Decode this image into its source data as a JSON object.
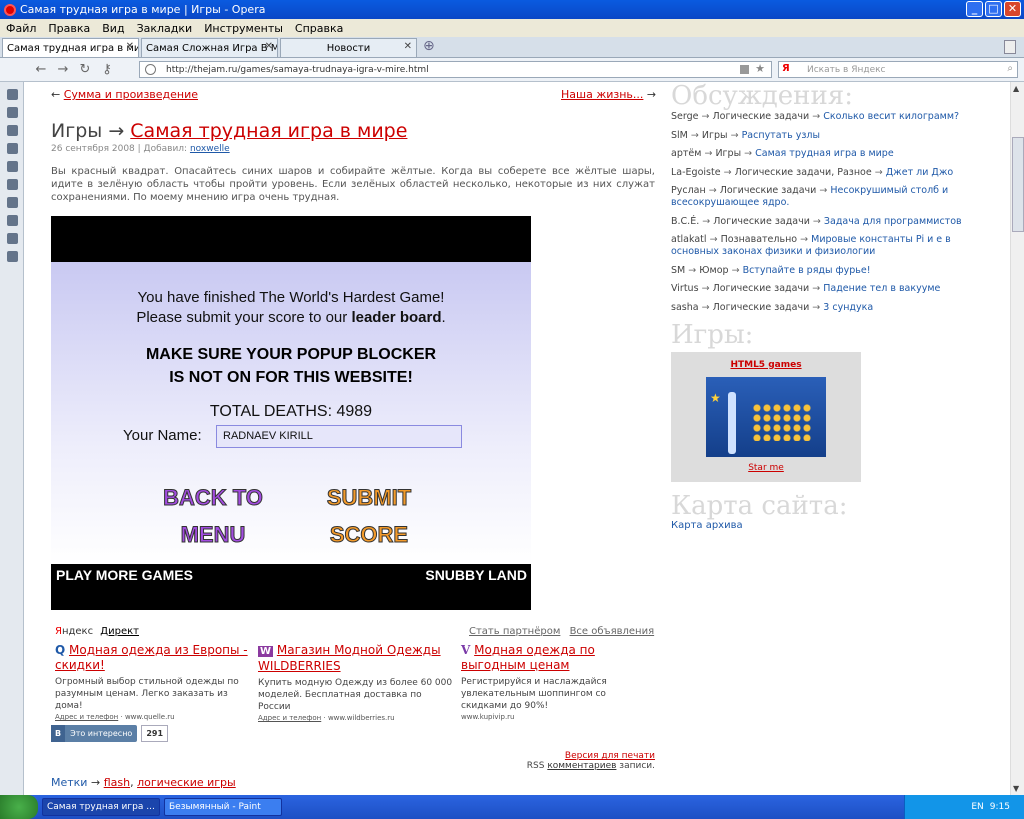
{
  "window": {
    "title": "Самая трудная игра в мире | Игры - Opera",
    "min": "_",
    "max": "□",
    "close": "✕"
  },
  "menu": [
    "Файл",
    "Правка",
    "Вид",
    "Закладки",
    "Инструменты",
    "Справка"
  ],
  "tabs": [
    {
      "label": "Самая трудная игра в мир...",
      "close": "✕"
    },
    {
      "label": "Самая Сложная Игра В Мир...",
      "close": "✕"
    },
    {
      "label": "Новости",
      "close": "✕"
    }
  ],
  "address": {
    "url": "http://thejam.ru/games/samaya-trudnaya-igra-v-mire.html",
    "search_placeholder": "Искать в Яндекс",
    "search_brand": "Я"
  },
  "nav": {
    "prev": "Сумма и произведение",
    "next": "Наша жизнь...",
    "prev_arrow": "←",
    "next_arrow": "→"
  },
  "article": {
    "category": "Игры",
    "arrow": "→",
    "title": "Самая трудная игра в мире",
    "date": "26 сентября 2008 | Добавил:",
    "author": "noxwelle",
    "text": "Вы красный квадрат. Опасайтесь синих шаров и собирайте жёлтые. Когда вы соберете все жёлтые шары, идите в зелёную область чтобы пройти уровень. Если зелёных областей несколько, некоторые из них служат сохранениями. По моему мнению игра очень трудная."
  },
  "game": {
    "line1": "You have finished The World's Hardest Game!",
    "line2_pre": "Please submit your score to our ",
    "line2_bold": "leader board",
    "line2_post": ".",
    "warn1": "MAKE SURE YOUR POPUP BLOCKER",
    "warn2": "IS NOT ON FOR THIS WEBSITE!",
    "deaths": "TOTAL DEATHS: 4989",
    "name_label": "Your Name:",
    "name_value": "RADNAEV KIRILL",
    "back1": "BACK TO",
    "back2": "MENU",
    "submit1": "SUBMIT",
    "submit2": "SCORE",
    "more_games": "PLAY MORE GAMES",
    "snubby": "SNUBBY LAND"
  },
  "ads": {
    "brand_ya": "Я",
    "brand_ndex": "ндекс",
    "direct": "Директ",
    "partner": "Стать партнёром",
    "all": "Все объявления",
    "items": [
      {
        "icon": "Q",
        "title": "Модная одежда из Европы - скидки!",
        "text": "Огромный выбор стильной одежды по разумным ценам. Легко заказать из дома!",
        "addr": "Адрес и телефон",
        "domain": "www.quelle.ru"
      },
      {
        "icon": "W",
        "title": "Магазин Модной Одежды WILDBERRIES",
        "text": "Купить модную Одежду из более 60 000 моделей. Бесплатная доставка по России",
        "addr": "Адрес и телефон",
        "domain": "www.wildberries.ru"
      },
      {
        "icon": "V",
        "title": "Модная одежда по выгодным ценам",
        "text": "Регистрируйся и наслаждайся увлекательным шоппингом со скидками до 90%!",
        "addr": "",
        "domain": "www.kupivip.ru"
      }
    ]
  },
  "social": {
    "vk": "В",
    "label": "Это интересно",
    "count": "291"
  },
  "print": "Версия для печати",
  "rss": {
    "pre": "RSS ",
    "link": "комментариев",
    "post": " записи."
  },
  "tags": {
    "label": "Метки",
    "arrow": "→",
    "items": [
      "flash",
      "логические игры"
    ]
  },
  "discussions": {
    "title": "Обсуждения:",
    "items": [
      {
        "user": "Serge",
        "cat": "Логические задачи",
        "topic": "Сколько весит килограмм?"
      },
      {
        "user": "SlM",
        "cat": "Игры",
        "topic": "Распутать узлы"
      },
      {
        "user": "артём",
        "cat": "Игры",
        "topic": "Самая трудная игра в мире"
      },
      {
        "user": "La-Egoiste",
        "cat": "Логические задачи, Разное",
        "topic": "Джет ли Джо"
      },
      {
        "user": "Руслан",
        "cat": "Логические задачи",
        "topic": "Несокрушимый столб и всесокрушающее ядро."
      },
      {
        "user": "B.C.É.",
        "cat": "Логические задачи",
        "topic": "Задача для программистов"
      },
      {
        "user": "atlakatl",
        "cat": "Познавательно",
        "topic": "Мировые константы Pi и е в основных законах физики и физиологии"
      },
      {
        "user": "SM",
        "cat": "Юмор",
        "topic": "Вступайте в ряды фурье!"
      },
      {
        "user": "Virtus",
        "cat": "Логические задачи",
        "topic": "Падение тел в вакууме"
      },
      {
        "user": "sasha",
        "cat": "Логические задачи",
        "topic": "3 сундука"
      }
    ]
  },
  "games_box": {
    "title": "Игры:",
    "html5": "HTML5 games",
    "star": "Star me"
  },
  "sitemap": {
    "title": "Карта сайта:",
    "link": "Карта архива"
  },
  "taskbar": {
    "tasks": [
      "Самая трудная игра ...",
      "Безымянный - Paint"
    ],
    "lang": "EN",
    "time": "9:15"
  },
  "colors": {
    "accent": "#cc0000",
    "link_blue": "#1f59a8",
    "game_bg": "#d9d9f5",
    "purple": "#9a3fd6",
    "orange": "#f08a24"
  }
}
